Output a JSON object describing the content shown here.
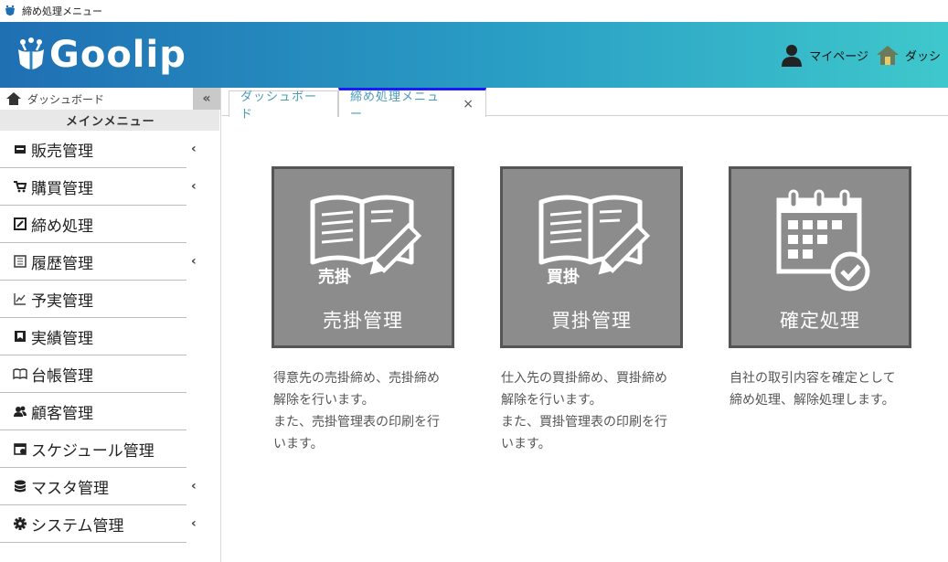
{
  "window": {
    "title": "締め処理メニュー"
  },
  "header": {
    "logo_text": "Goolip",
    "mypage_label": "マイページ",
    "dashboard_label": "ダッシ"
  },
  "sidebar": {
    "dashboard_label": "ダッシュボード",
    "collapse_label": "«",
    "main_menu_label": "メインメニュー",
    "items": [
      {
        "label": "販売管理",
        "icon": "store-icon",
        "has_submenu": true
      },
      {
        "label": "購買管理",
        "icon": "cart-icon",
        "has_submenu": true
      },
      {
        "label": "締め処理",
        "icon": "checkbox-edit-icon",
        "has_submenu": false
      },
      {
        "label": "履歴管理",
        "icon": "history-list-icon",
        "has_submenu": true
      },
      {
        "label": "予実管理",
        "icon": "line-chart-icon",
        "has_submenu": false
      },
      {
        "label": "実績管理",
        "icon": "bookmark-icon",
        "has_submenu": false
      },
      {
        "label": "台帳管理",
        "icon": "book-icon",
        "has_submenu": false
      },
      {
        "label": "顧客管理",
        "icon": "users-icon",
        "has_submenu": false
      },
      {
        "label": "スケジュール管理",
        "icon": "calendar-icon",
        "has_submenu": false
      },
      {
        "label": "マスタ管理",
        "icon": "database-icon",
        "has_submenu": true
      },
      {
        "label": "システム管理",
        "icon": "gear-icon",
        "has_submenu": true
      }
    ],
    "chevron": "‹"
  },
  "tabs": [
    {
      "label": "ダッシュボード",
      "active": false
    },
    {
      "label": "締め処理メニュー",
      "active": true,
      "close": "×"
    }
  ],
  "cards": [
    {
      "name": "accounts-receivable",
      "label": "売掛管理",
      "icon_caption": "売掛",
      "icon": "open-book-pencil-icon",
      "description": [
        "得意先の売掛締め、売掛締め",
        "解除を行います。",
        "また、売掛管理表の印刷を行",
        "います。"
      ]
    },
    {
      "name": "accounts-payable",
      "label": "買掛管理",
      "icon_caption": "買掛",
      "icon": "open-book-pencil-icon",
      "description": [
        "仕入先の買掛締め、買掛締め",
        "解除を行います。",
        "また、買掛管理表の印刷を行",
        "います。"
      ]
    },
    {
      "name": "confirm-process",
      "label": "確定処理",
      "icon": "calendar-check-icon",
      "description": [
        "自社の取引内容を確定として",
        "締め処理、解除処理します。"
      ]
    }
  ],
  "colors": {
    "header_start": "#1f6fb3",
    "header_end": "#3fc8cc",
    "card_bg": "#8c8c8c",
    "card_border": "#555555",
    "tab_text": "#4a9ab8",
    "active_tab_accent": "#1a1aff"
  }
}
